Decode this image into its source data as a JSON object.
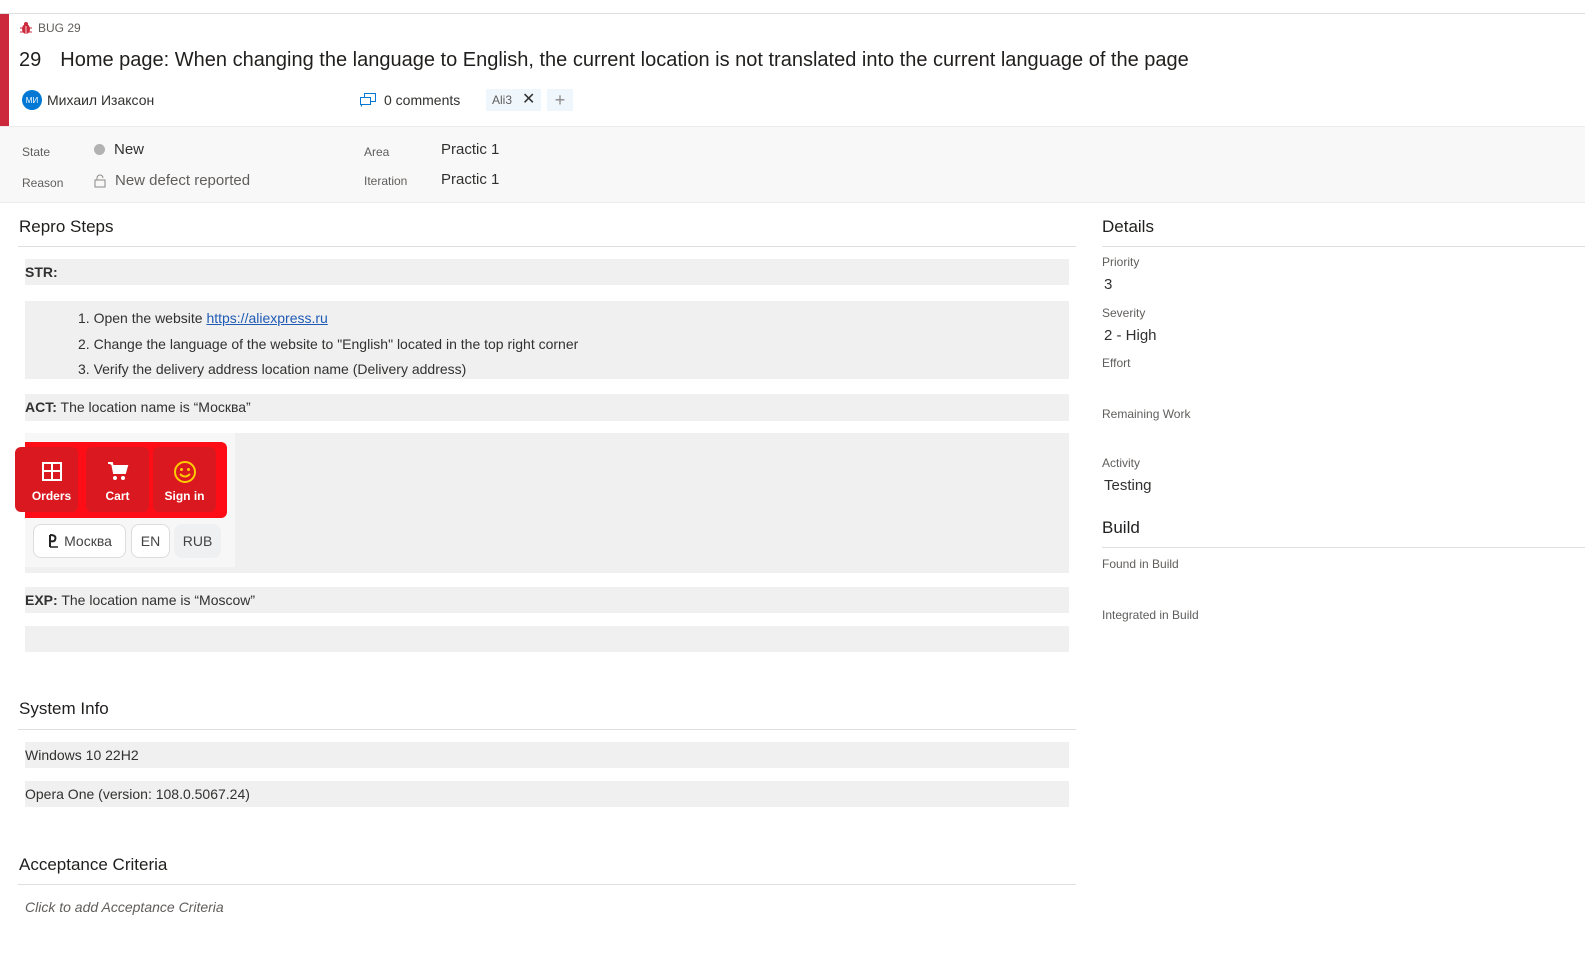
{
  "workitem": {
    "type_label": "BUG 29",
    "id": "29",
    "title": "Home page: When changing the language to English, the current location is not translated into the current language of the page",
    "author_initials": "МИ",
    "author_name": "Михаил Изаксон",
    "comments_label": "0 comments",
    "tags": [
      "Ali3"
    ],
    "accent_color": "#cc293d"
  },
  "fields": {
    "state_label": "State",
    "state_value": "New",
    "reason_label": "Reason",
    "reason_value": "New defect reported",
    "area_label": "Area",
    "area_value": "Practic 1",
    "iteration_label": "Iteration",
    "iteration_value": "Practic 1"
  },
  "repro": {
    "title": "Repro Steps",
    "str_label": "STR:",
    "steps": [
      {
        "num": "1.",
        "text": "Open the website ",
        "link": "https://aliexpress.ru"
      },
      {
        "num": "2.",
        "text": "Change the language of the website to \"English\" located in the top right corner"
      },
      {
        "num": "3.",
        "text": "Verify the delivery address location name (Delivery address)"
      }
    ],
    "act_label": "ACT:",
    "act_text": " The location name is “Москва”",
    "exp_label": "EXP:",
    "exp_text": " The location name is “Moscow”",
    "screenshot": {
      "orders": "Orders",
      "cart": "Cart",
      "signin": "Sign in",
      "location": "Москва",
      "lang": "EN",
      "currency": "RUB"
    }
  },
  "system_info": {
    "title": "System Info",
    "lines": [
      "Windows 10 22H2",
      "Opera One (version: 108.0.5067.24)"
    ]
  },
  "acceptance": {
    "title": "Acceptance Criteria",
    "placeholder": "Click to add Acceptance Criteria"
  },
  "details": {
    "title": "Details",
    "priority_label": "Priority",
    "priority_value": "3",
    "severity_label": "Severity",
    "severity_value": "2 - High",
    "effort_label": "Effort",
    "effort_value": "",
    "remaining_label": "Remaining Work",
    "remaining_value": "",
    "activity_label": "Activity",
    "activity_value": "Testing"
  },
  "build": {
    "title": "Build",
    "found_label": "Found in Build",
    "integrated_label": "Integrated in Build"
  }
}
